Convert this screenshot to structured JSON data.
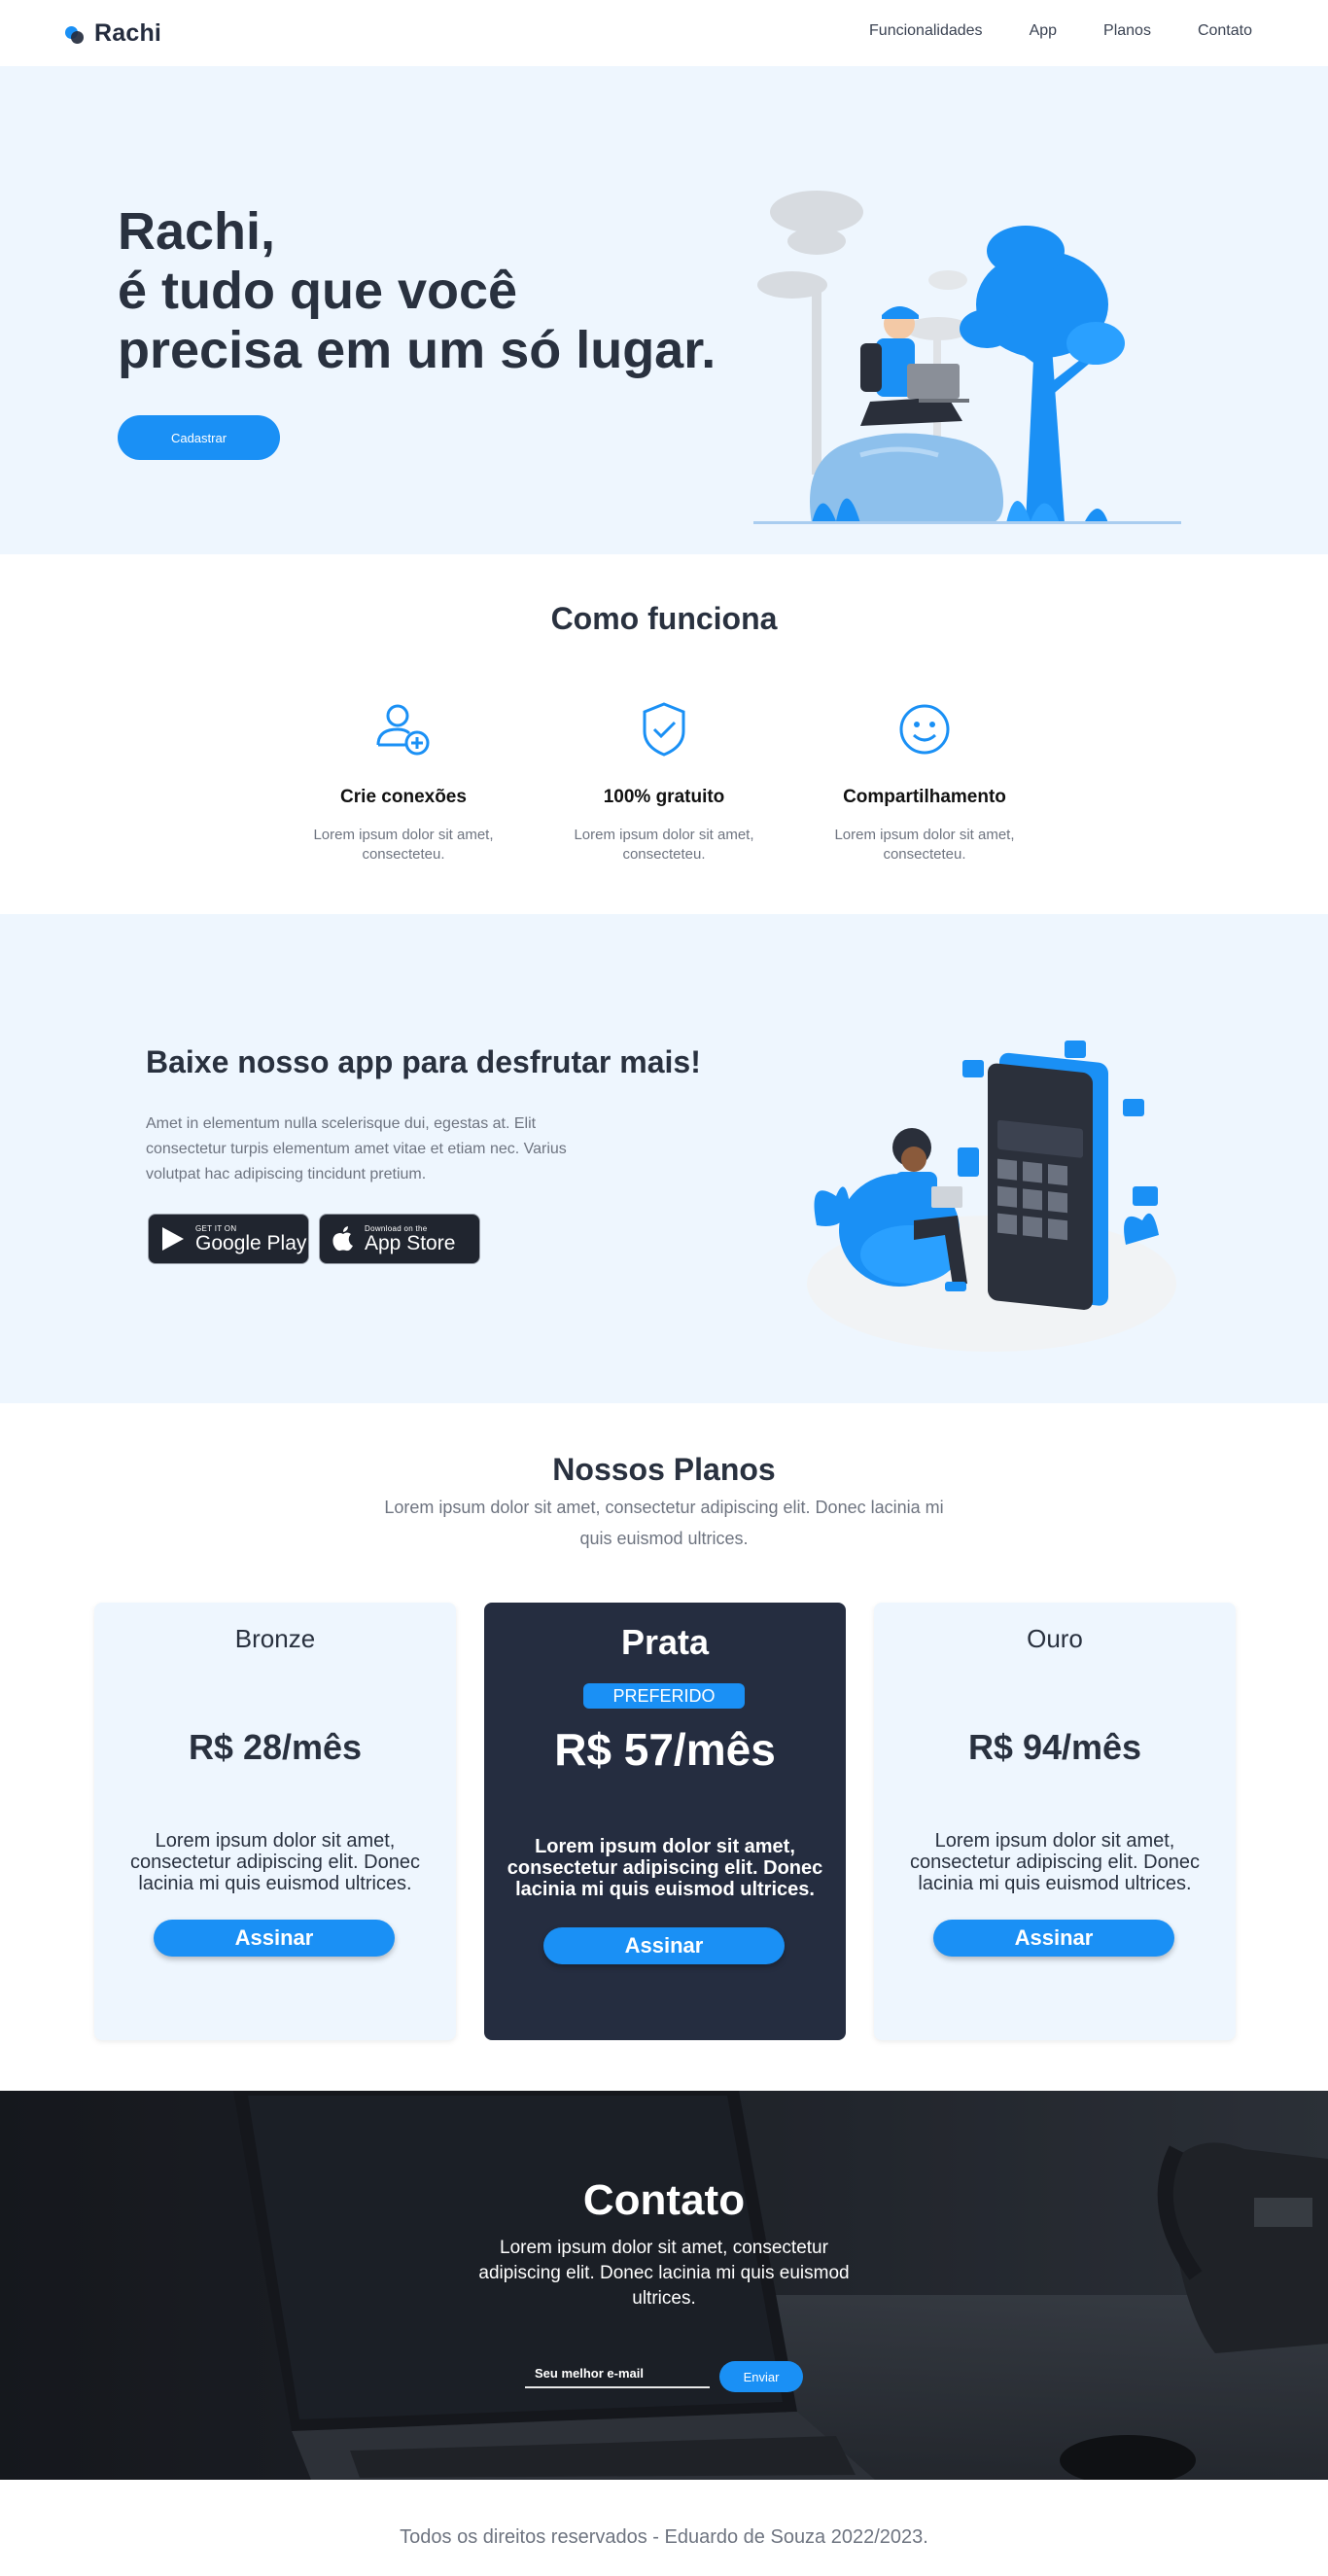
{
  "header": {
    "brand": "Rachi",
    "nav": [
      {
        "label": "Funcionalidades"
      },
      {
        "label": "App"
      },
      {
        "label": "Planos"
      },
      {
        "label": "Contato"
      }
    ]
  },
  "hero": {
    "title_lines": [
      "Rachi,",
      "é tudo que você",
      "precisa em um só lugar."
    ],
    "cta_label": "Cadastrar"
  },
  "how": {
    "title": "Como funciona",
    "features": [
      {
        "icon": "add-user-icon",
        "title": "Crie conexões",
        "text": "Lorem ipsum dolor sit amet, consecteteu."
      },
      {
        "icon": "shield-check-icon",
        "title": "100% gratuito",
        "text": "Lorem ipsum dolor sit amet, consecteteu."
      },
      {
        "icon": "smile-icon",
        "title": "Compartilhamento",
        "text": "Lorem ipsum dolor sit amet, consecteteu."
      }
    ]
  },
  "app": {
    "title": "Baixe nosso app para desfrutar mais!",
    "text": "Amet in elementum nulla scelerisque dui, egestas at. Elit consectetur turpis elementum amet vitae et etiam nec. Varius volutpat hac adipiscing tincidunt pretium.",
    "google_small": "GET IT ON",
    "google_big": "Google Play",
    "apple_small": "Download on the",
    "apple_big": "App Store"
  },
  "plans": {
    "title": "Nossos Planos",
    "subtitle": "Lorem ipsum dolor sit amet, consectetur adipiscing elit. Donec lacinia mi quis euismod ultrices.",
    "items": [
      {
        "name": "Bronze",
        "price": "R$ 28/mês",
        "desc": "Lorem ipsum dolor sit amet, consectetur adipiscing elit. Donec lacinia mi quis euismod ultrices.",
        "button": "Assinar"
      },
      {
        "name": "Prata",
        "badge": "PREFERIDO",
        "price": "R$ 57/mês",
        "desc": "Lorem ipsum dolor sit amet, consectetur adipiscing elit. Donec lacinia mi quis euismod ultrices.",
        "button": "Assinar"
      },
      {
        "name": "Ouro",
        "price": "R$ 94/mês",
        "desc": "Lorem ipsum dolor sit amet, consectetur adipiscing elit. Donec lacinia mi quis euismod ultrices.",
        "button": "Assinar"
      }
    ]
  },
  "contact": {
    "title": "Contato",
    "text": "Lorem ipsum dolor sit amet, consectetur adipiscing elit. Donec lacinia mi quis euismod ultrices.",
    "email_placeholder": "Seu melhor e-mail",
    "button": "Enviar"
  },
  "footer": {
    "text": "Todos os direitos reservados - Eduardo de Souza 2022/2023."
  },
  "colors": {
    "accent": "#1a90f5",
    "dark": "#252d40",
    "light_bg": "#eef6fe"
  }
}
